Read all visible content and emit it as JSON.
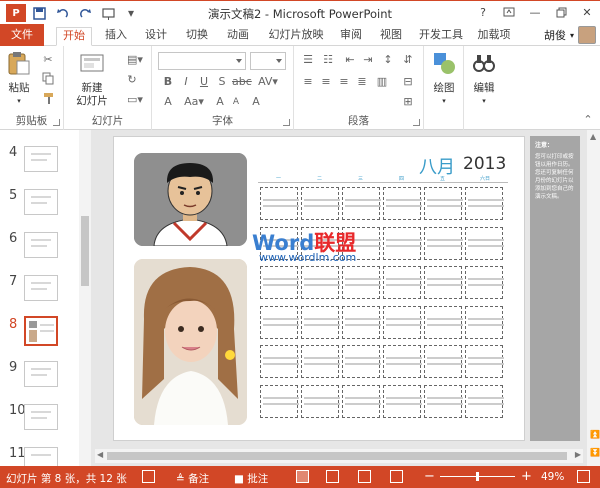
{
  "window": {
    "title": "演示文稿2 - Microsoft PowerPoint",
    "user": "胡俊",
    "help": "?"
  },
  "tabs": [
    "文件",
    "开始",
    "插入",
    "设计",
    "切换",
    "动画",
    "幻灯片放映",
    "审阅",
    "视图",
    "开发工具",
    "加载项"
  ],
  "ribbon": {
    "clipboard": {
      "label": "剪贴板",
      "paste": "粘贴"
    },
    "slides": {
      "label": "幻灯片",
      "new_slide_line1": "新建",
      "new_slide_line2": "幻灯片"
    },
    "font": {
      "label": "字体"
    },
    "paragraph": {
      "label": "段落"
    },
    "drawing": {
      "label": "绘图"
    },
    "editing": {
      "label": "编辑"
    }
  },
  "thumbnails": [
    {
      "num": "4",
      "selected": false
    },
    {
      "num": "5",
      "selected": false
    },
    {
      "num": "6",
      "selected": false
    },
    {
      "num": "7",
      "selected": false
    },
    {
      "num": "8",
      "selected": true
    },
    {
      "num": "9",
      "selected": false
    },
    {
      "num": "10",
      "selected": false
    },
    {
      "num": "11",
      "selected": false
    }
  ],
  "slide": {
    "month": "八月",
    "year": "2013",
    "weekdays": [
      "一",
      "二",
      "三",
      "四",
      "五",
      "六日"
    ],
    "watermark_prefix": "Word",
    "watermark_suffix": "联盟",
    "watermark_url": "www.wordlm.com"
  },
  "notes": {
    "heading": "注意：",
    "body": "您可以打印或按钮以用作日历。您还可复制任何月份的幻灯片以添加到您自己的演示文稿。"
  },
  "status": {
    "slide_info": "幻灯片 第 8 张，共 12 张",
    "notes": "备注",
    "comments": "批注",
    "zoom": "49%"
  },
  "colors": {
    "accent": "#d24726",
    "month": "#3a9cc9"
  }
}
